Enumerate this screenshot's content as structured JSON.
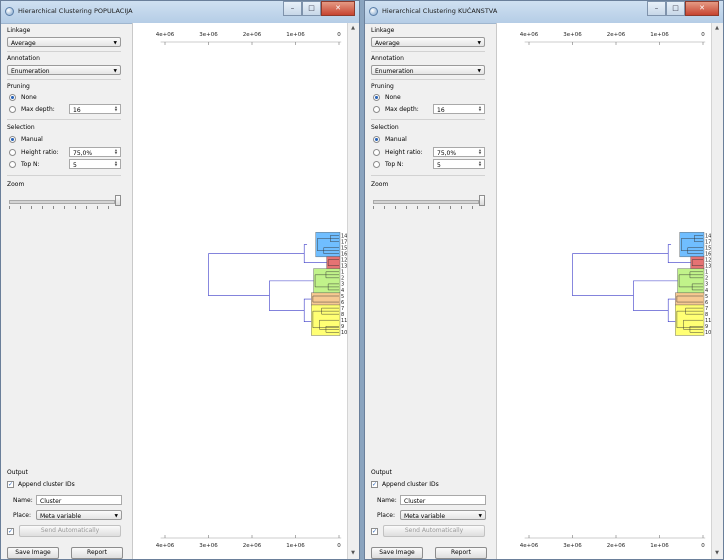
{
  "windows": [
    {
      "title": "Hierarchical Clustering POPULACIJA",
      "controls": [
        "–",
        "□",
        "✕"
      ],
      "linkage": {
        "label": "Linkage",
        "value": "Average"
      },
      "annotation": {
        "label": "Annotation",
        "value": "Enumeration"
      },
      "pruning": {
        "label": "Pruning",
        "none": "None",
        "max_depth": "Max depth:",
        "max_depth_value": "16",
        "selected": "None"
      },
      "selection": {
        "label": "Selection",
        "manual": "Manual",
        "height_ratio": "Height ratio:",
        "height_ratio_value": "75,0%",
        "top_n": "Top N:",
        "top_n_value": "5",
        "selected": "Manual"
      },
      "zoom": {
        "label": "Zoom",
        "level": 1.0
      },
      "output": {
        "label": "Output",
        "append": "Append cluster IDs",
        "append_checked": true,
        "name_label": "Name:",
        "name_value": "Cluster",
        "place_label": "Place:",
        "place_value": "Meta variable",
        "auto_checked": true,
        "send": "Send Automatically"
      },
      "buttons": {
        "save": "Save Image",
        "report": "Report"
      }
    },
    {
      "title": "Hierarchical Clustering KUĆANSTVA",
      "controls": [
        "–",
        "□",
        "✕"
      ],
      "linkage": {
        "label": "Linkage",
        "value": "Average"
      },
      "annotation": {
        "label": "Annotation",
        "value": "Enumeration"
      },
      "pruning": {
        "label": "Pruning",
        "none": "None",
        "max_depth": "Max depth:",
        "max_depth_value": "16",
        "selected": "None"
      },
      "selection": {
        "label": "Selection",
        "manual": "Manual",
        "height_ratio": "Height ratio:",
        "height_ratio_value": "75,0%",
        "top_n": "Top N:",
        "top_n_value": "5",
        "selected": "Manual"
      },
      "zoom": {
        "label": "Zoom",
        "level": 1.0
      },
      "output": {
        "label": "Output",
        "append": "Append cluster IDs",
        "append_checked": true,
        "name_label": "Name:",
        "name_value": "Cluster",
        "place_label": "Place:",
        "place_value": "Meta variable",
        "auto_checked": true,
        "send": "Send Automatically"
      },
      "buttons": {
        "save": "Save Image",
        "report": "Report"
      }
    }
  ],
  "dendrogram": {
    "axis_top_ticks": [
      "4e+06",
      "3e+06",
      "2e+06",
      "1e+06",
      "0"
    ],
    "axis_bottom_ticks": [
      "4e+06",
      "3e+06",
      "2e+06",
      "1e+06",
      "0"
    ],
    "leaves": [
      "14",
      "17",
      "15",
      "16",
      "12",
      "13",
      "1",
      "2",
      "3",
      "4",
      "5",
      "6",
      "7",
      "8",
      "11",
      "9",
      "10"
    ],
    "cluster_colors": {
      "blue": "#57b3ff",
      "red": "#e15a5a",
      "green": "#b6f176",
      "orange": "#f4c07f",
      "yellow": "#ffff5c",
      "link": "#3a3ac8"
    }
  }
}
